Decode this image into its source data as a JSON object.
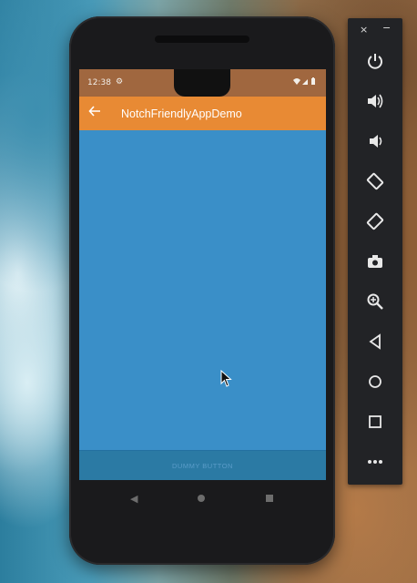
{
  "status_bar": {
    "time": "12:38",
    "settings_icon": "gear-icon",
    "right_icons": "wifi signal battery"
  },
  "app_bar": {
    "back_icon": "arrow-left-icon",
    "title": "NotchFriendlyAppDemo"
  },
  "bottom": {
    "dummy_button_label": "DUMMY BUTTON"
  },
  "nav": {
    "back": "nav-back-icon",
    "home": "nav-home-icon",
    "recent": "nav-recent-icon"
  },
  "emulator_toolbar": {
    "close": "×",
    "minimize": "−",
    "buttons": [
      "power",
      "volume-up",
      "volume-down",
      "rotate-left",
      "rotate-right",
      "screenshot",
      "zoom",
      "back",
      "home",
      "overview",
      "more"
    ]
  },
  "colors": {
    "status_bar": "#a0673f",
    "app_bar": "#e88a34",
    "content": "#3a8fc8",
    "bottom_bar": "#2b7aa4",
    "toolbar": "#222326"
  }
}
